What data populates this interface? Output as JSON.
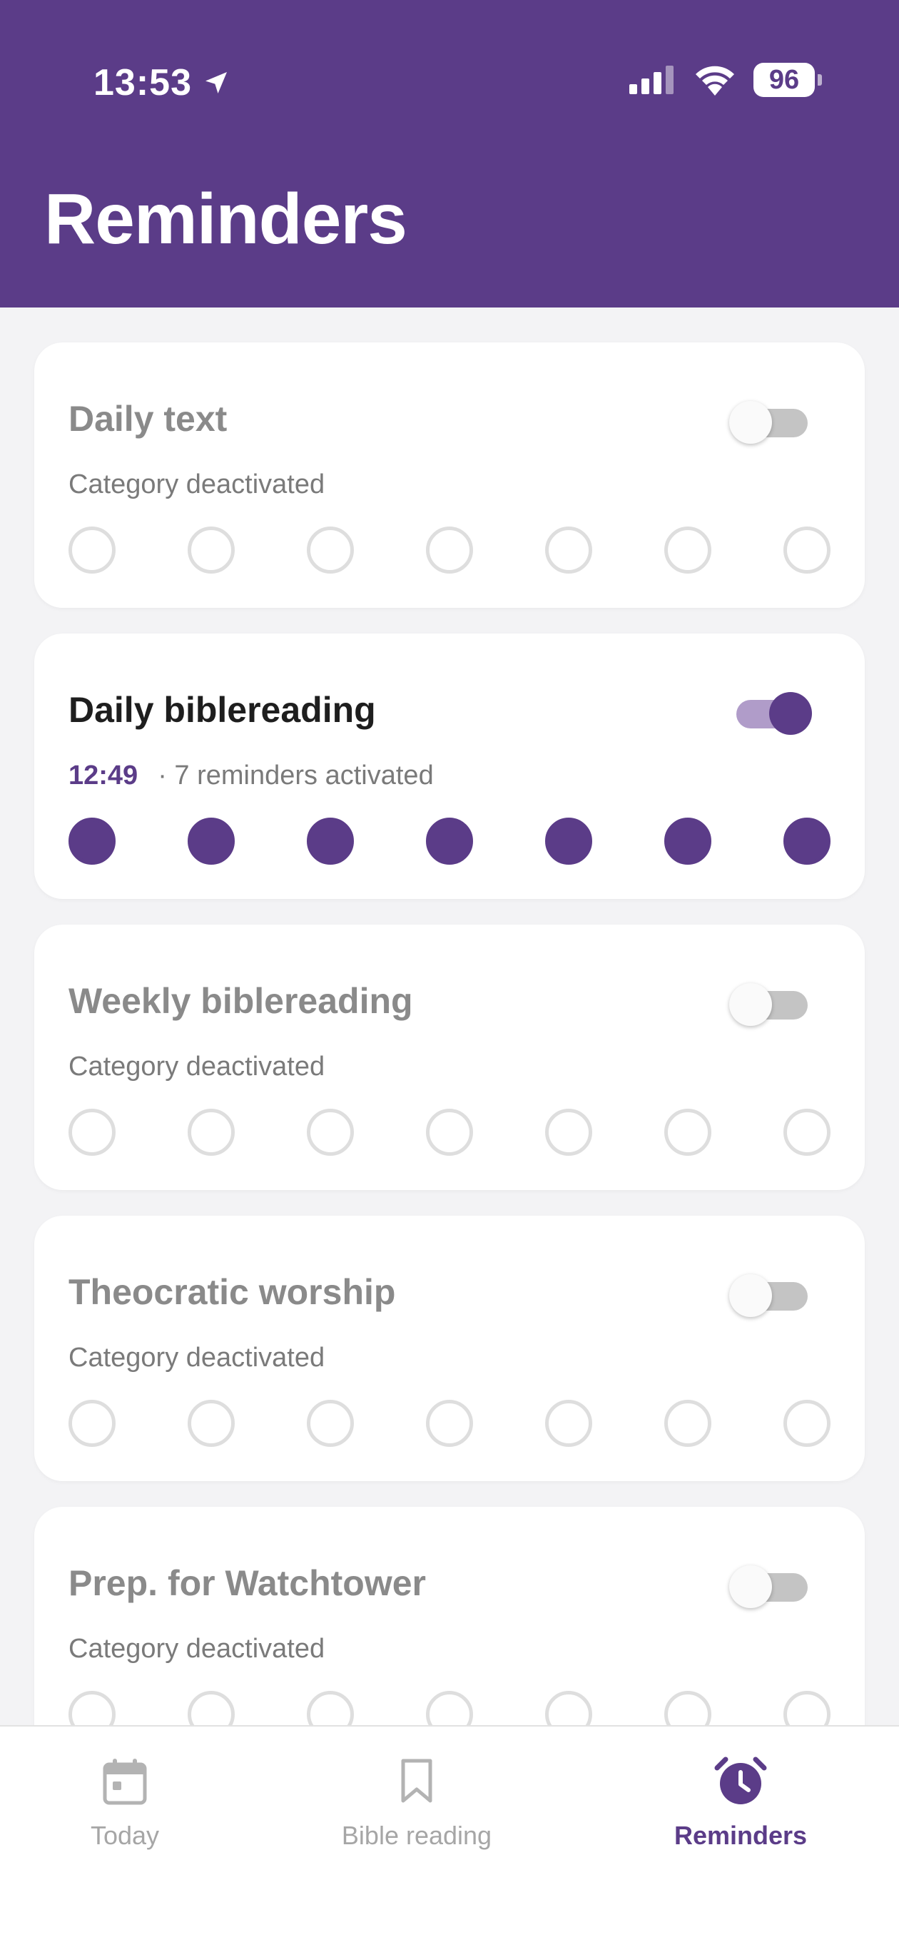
{
  "status": {
    "time": "13:53",
    "battery": "96"
  },
  "header": {
    "title": "Reminders"
  },
  "colors": {
    "accent": "#5b3c88",
    "inactive": "#8a8a8a"
  },
  "cards": [
    {
      "title": "Daily text",
      "subtitle": "Category deactivated",
      "time": "",
      "active": false
    },
    {
      "title": "Daily biblereading",
      "subtitle": "· 7 reminders activated",
      "time": "12:49",
      "active": true
    },
    {
      "title": "Weekly biblereading",
      "subtitle": "Category deactivated",
      "time": "",
      "active": false
    },
    {
      "title": "Theocratic worship",
      "subtitle": "Category deactivated",
      "time": "",
      "active": false
    },
    {
      "title": "Prep. for Watchtower",
      "subtitle": "Category deactivated",
      "time": "",
      "active": false
    }
  ],
  "tabs": [
    {
      "label": "Today",
      "icon": "calendar-icon",
      "active": false
    },
    {
      "label": "Bible reading",
      "icon": "bookmark-icon",
      "active": false
    },
    {
      "label": "Reminders",
      "icon": "alarm-clock-icon",
      "active": true
    }
  ]
}
